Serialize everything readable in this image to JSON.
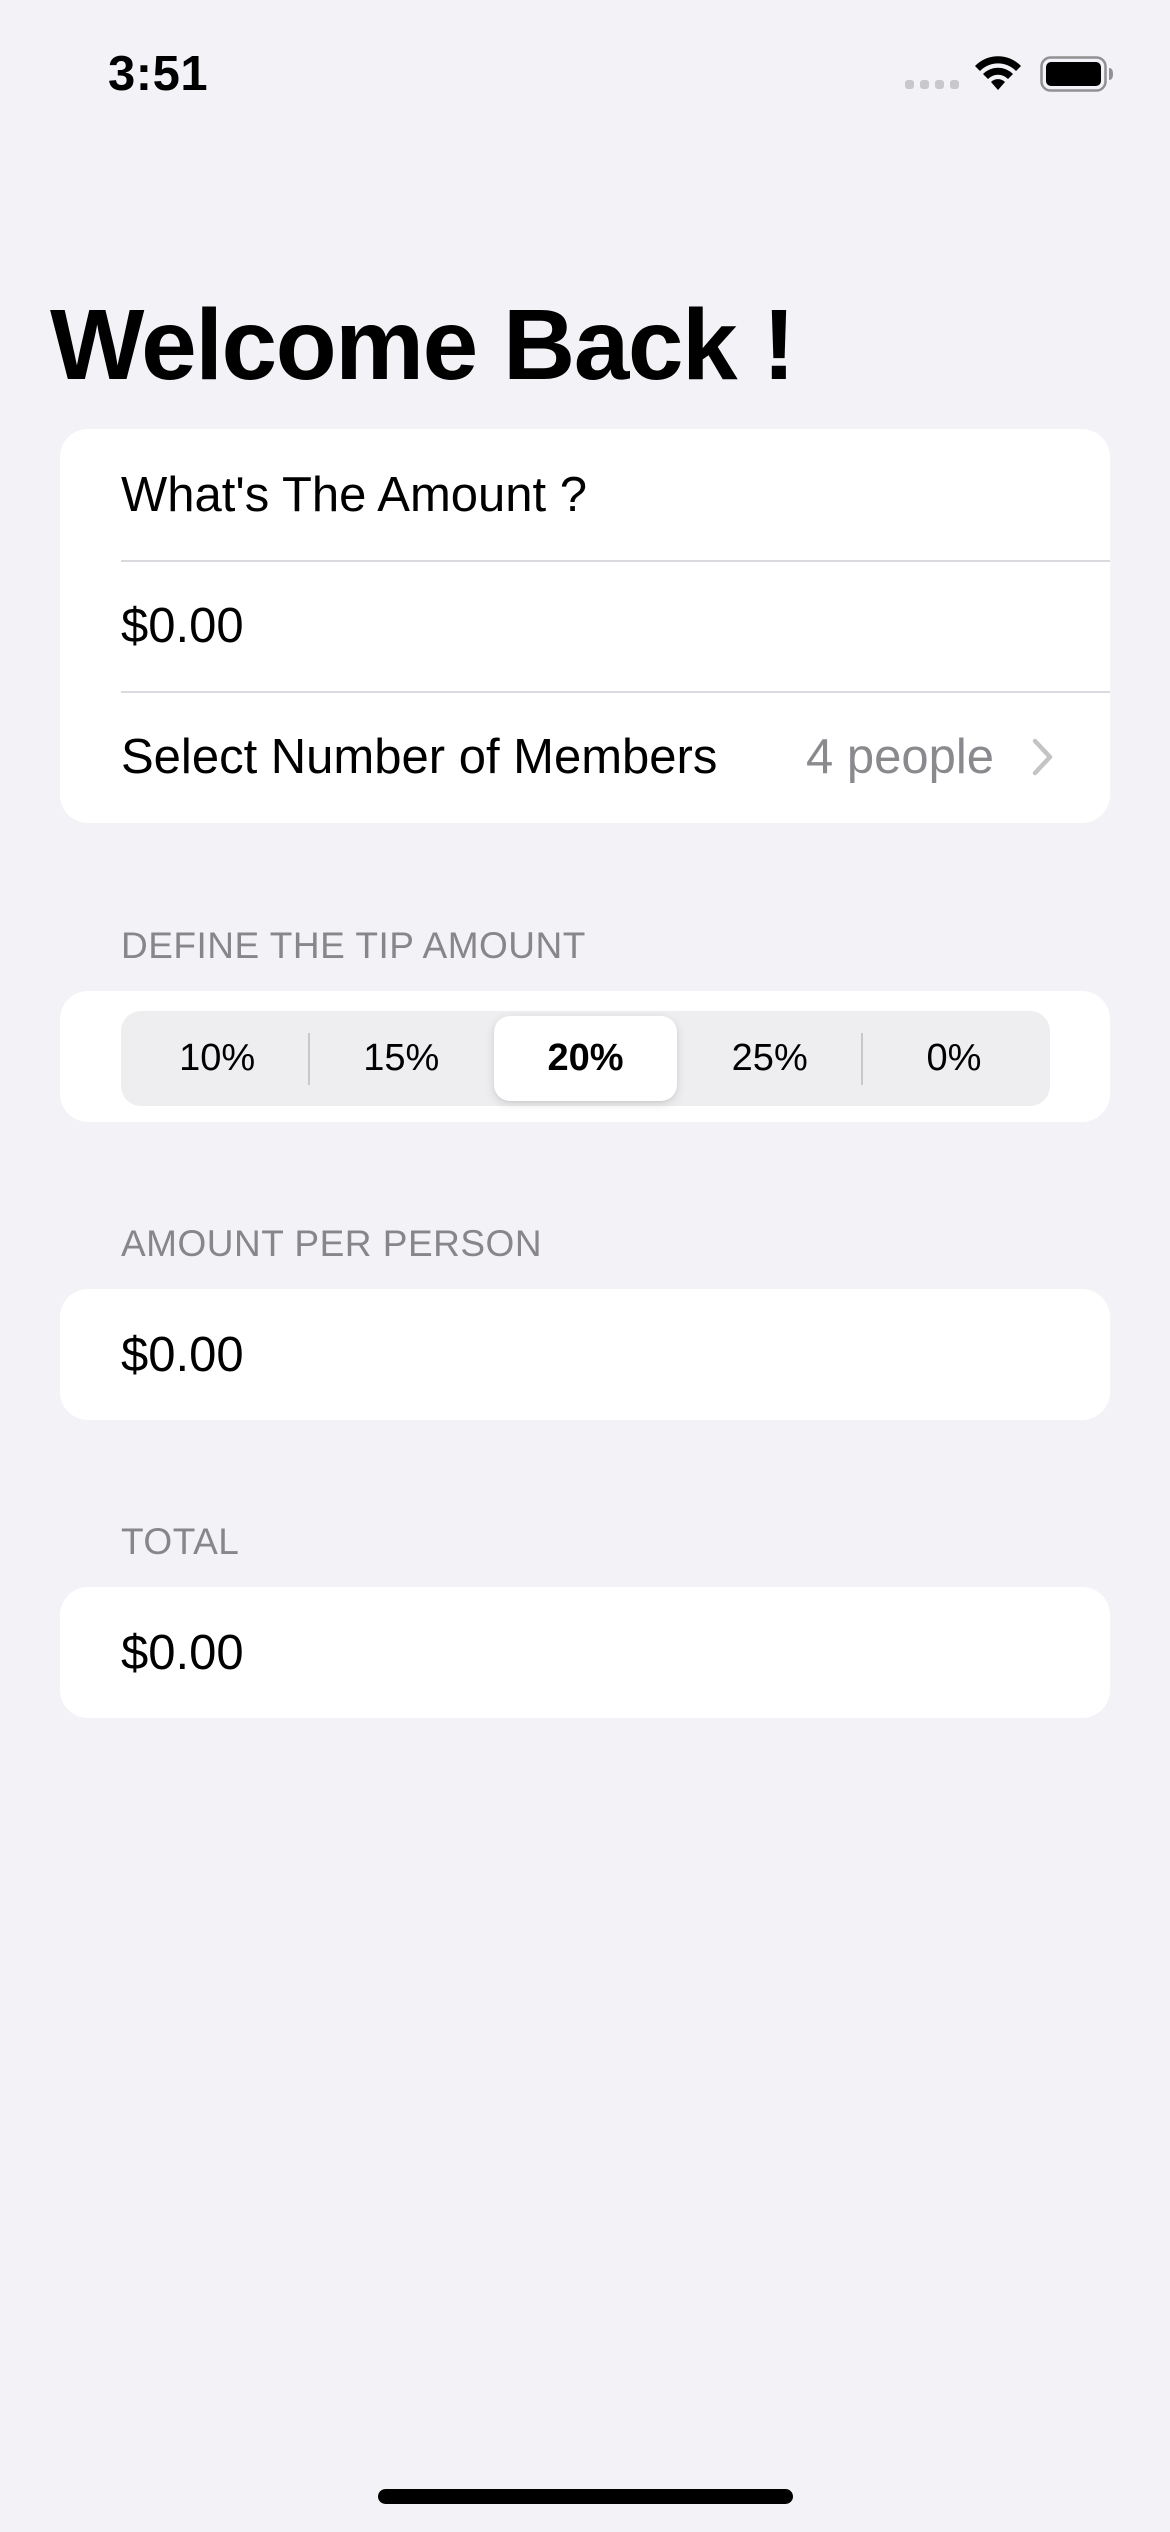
{
  "status_bar": {
    "time": "3:51",
    "icons": [
      "signal-icon",
      "wifi-icon",
      "battery-icon"
    ]
  },
  "title": "Welcome Back !",
  "amount_section": {
    "header_label": "What's The Amount ?",
    "amount_value": "$0.00",
    "members_label": "Select Number of Members",
    "members_value": "4 people",
    "chevron": "chevron-right-icon"
  },
  "tip_section": {
    "header": "DEFINE THE TIP AMOUNT",
    "options": [
      "10%",
      "15%",
      "20%",
      "25%",
      "0%"
    ],
    "selected": "20%"
  },
  "per_person_section": {
    "header": "AMOUNT PER PERSON",
    "value": "$0.00"
  },
  "total_section": {
    "header": "TOTAL",
    "value": "$0.00"
  },
  "colors": {
    "background": "#f2f2f7",
    "card": "#ffffff",
    "secondary_text": "#8a8a8e",
    "section_header": "#86868b"
  }
}
